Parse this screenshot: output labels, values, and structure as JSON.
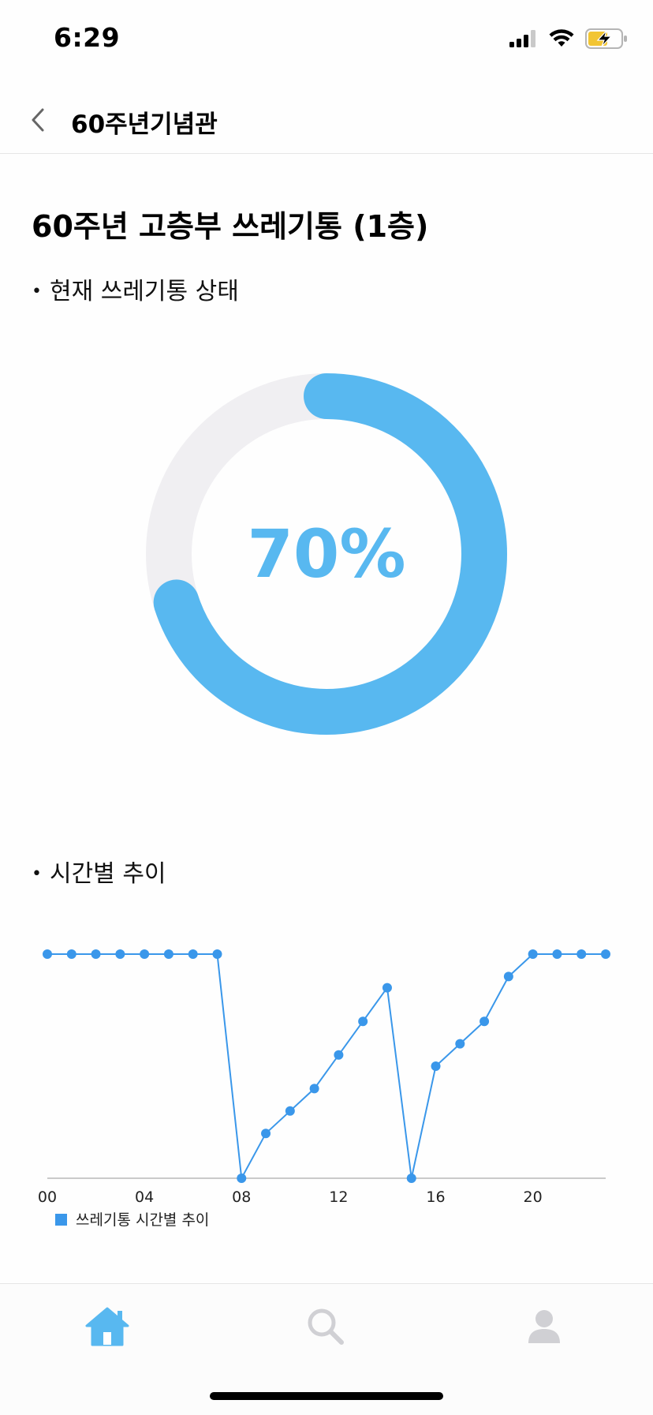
{
  "status_bar": {
    "time": "6:29"
  },
  "nav": {
    "title": "60주년기념관"
  },
  "page": {
    "title": "60주년 고층부 쓰레기통 (1층)"
  },
  "current_status": {
    "label": "현재 쓰레기통 상태",
    "percent_text": "70%",
    "fill_fraction": 0.7,
    "fill_color": "#58b8f0",
    "track_color": "#f0eff2"
  },
  "trend": {
    "label": "시간별 추이"
  },
  "chart_data": {
    "type": "line",
    "x": [
      0,
      1,
      2,
      3,
      4,
      5,
      6,
      7,
      8,
      9,
      10,
      11,
      12,
      13,
      14,
      15,
      16,
      17,
      18,
      19,
      20,
      21,
      22,
      23
    ],
    "x_tick_labels": [
      "00",
      "04",
      "08",
      "12",
      "16",
      "20"
    ],
    "x_ticks": [
      0,
      4,
      8,
      12,
      16,
      20
    ],
    "series": [
      {
        "name": "쓰레기통 시간별 추이",
        "color": "#3a97ea",
        "values": [
          100,
          100,
          100,
          100,
          100,
          100,
          100,
          100,
          0,
          20,
          30,
          40,
          55,
          70,
          85,
          0,
          50,
          60,
          70,
          90,
          100,
          100,
          100,
          100
        ]
      }
    ],
    "ylim": [
      0,
      100
    ],
    "grid": false,
    "legend": "bottom-left"
  },
  "tabs": [
    {
      "name": "home",
      "icon": "home-icon",
      "active": true
    },
    {
      "name": "search",
      "icon": "search-icon",
      "active": false
    },
    {
      "name": "profile",
      "icon": "user-icon",
      "active": false
    }
  ]
}
